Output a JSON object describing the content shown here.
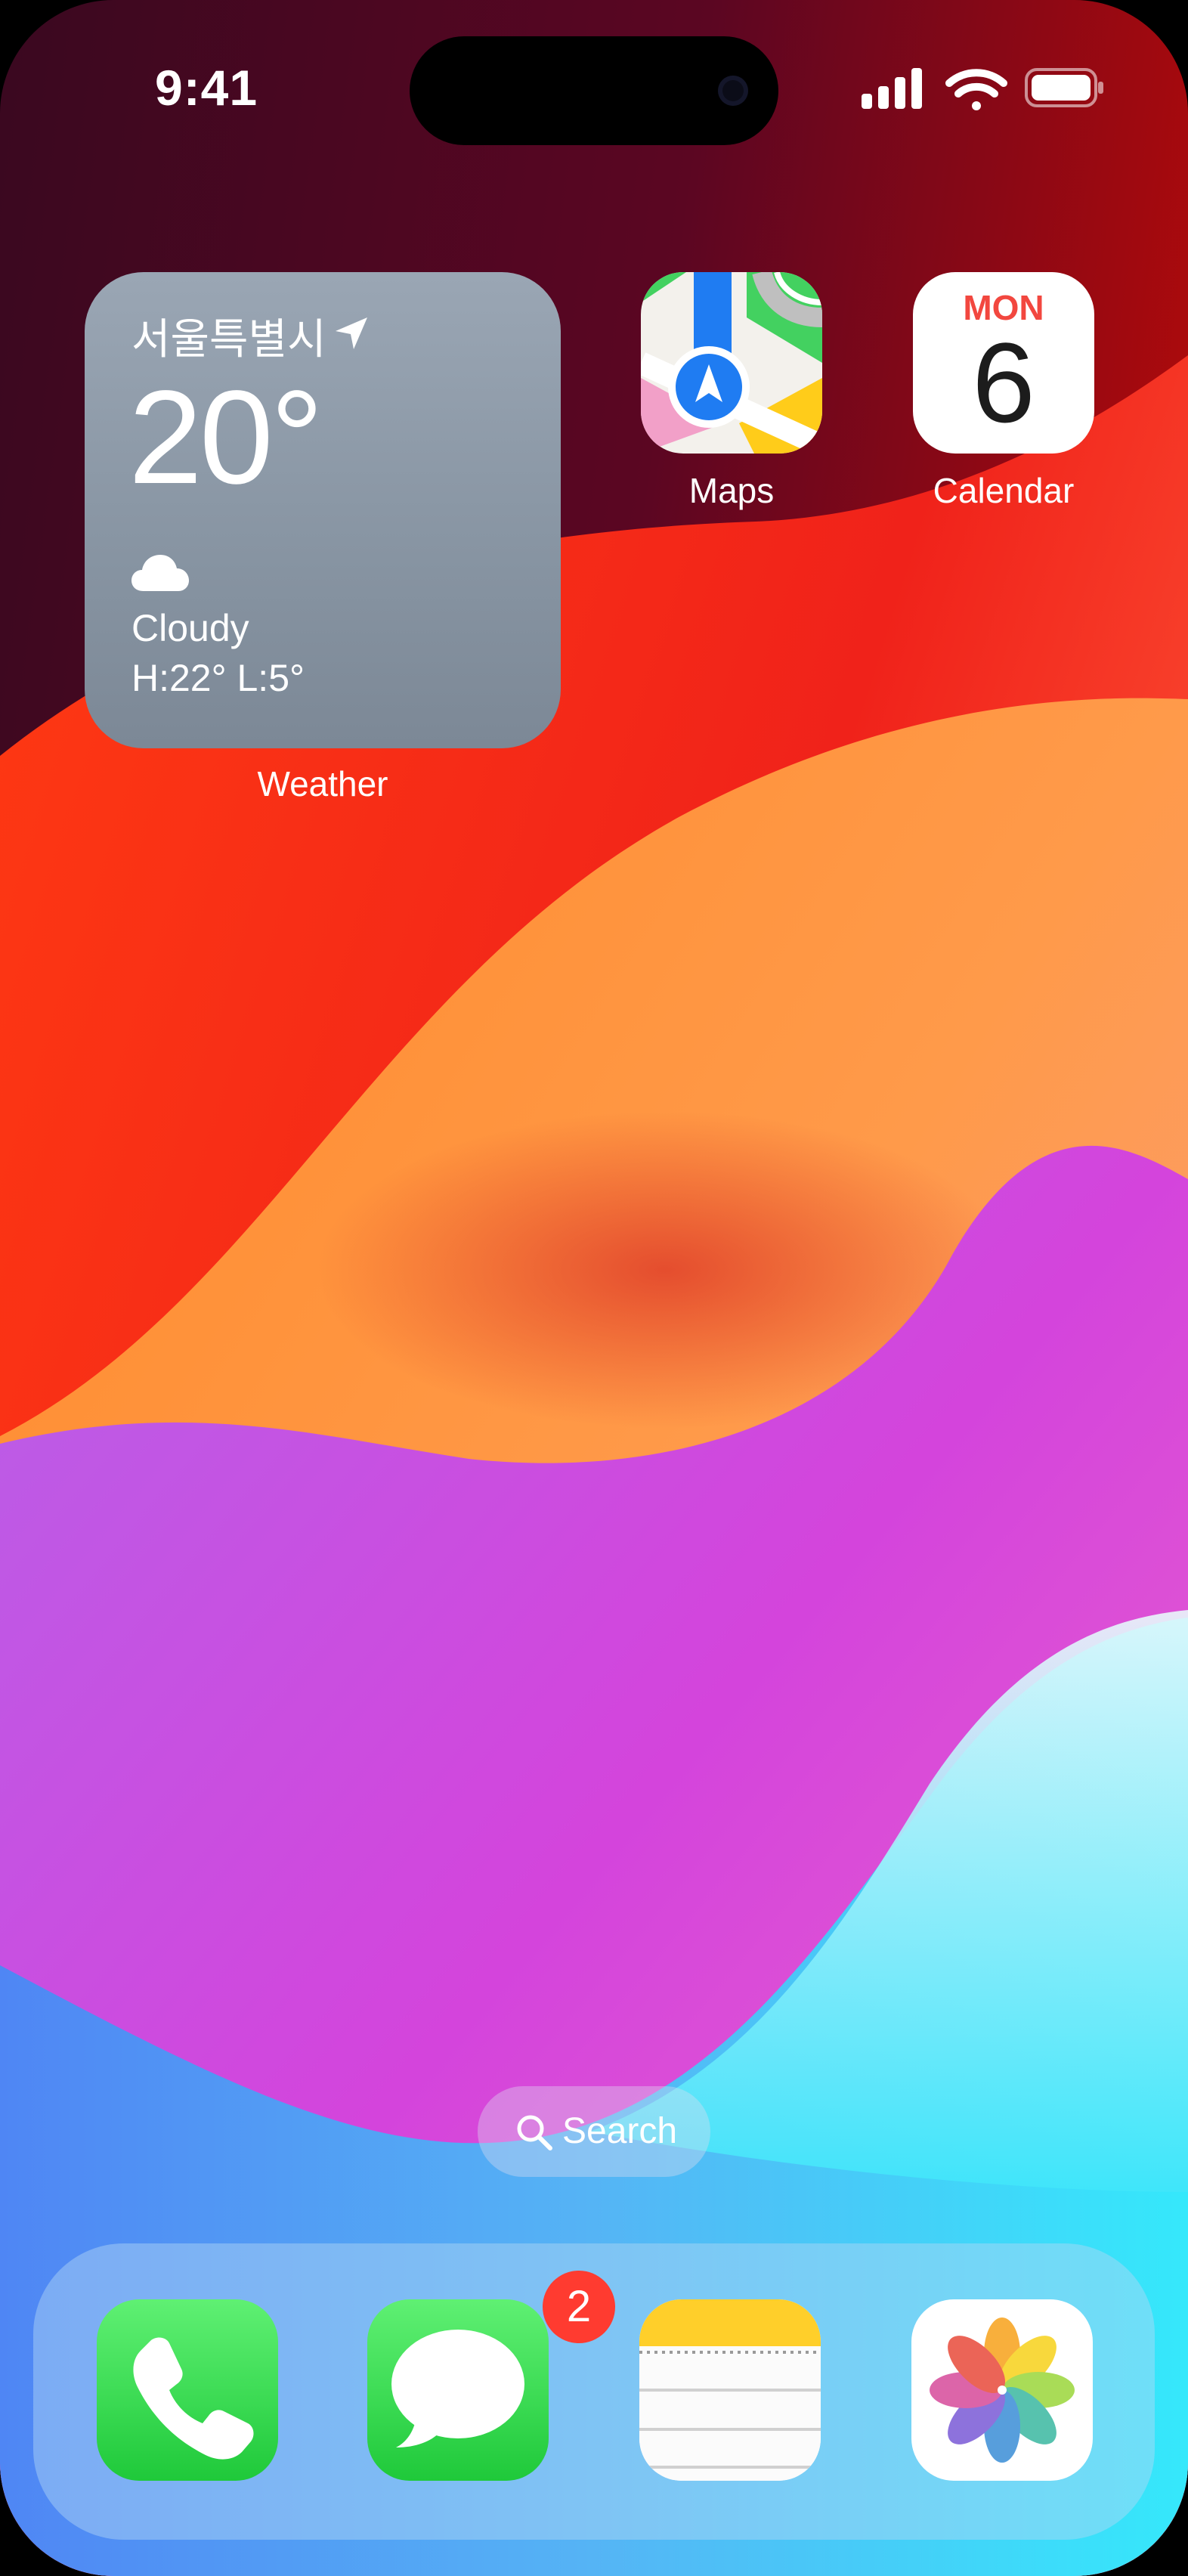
{
  "status_bar": {
    "time": "9:41"
  },
  "weather_widget": {
    "city": "서울특별시",
    "temperature": "20°",
    "condition": "Cloudy",
    "high_low": "H:22° L:5°",
    "label": "Weather"
  },
  "apps": {
    "maps": {
      "label": "Maps"
    },
    "calendar": {
      "label": "Calendar",
      "weekday": "MON",
      "day": "6"
    }
  },
  "search": {
    "label": "Search"
  },
  "dock": {
    "messages_badge": "2",
    "apps": [
      "phone",
      "messages",
      "notes",
      "photos"
    ]
  },
  "colors": {
    "badge": "#ff3b30",
    "calendar_accent": "#f2473f",
    "messages_green": "#1fc93a"
  }
}
